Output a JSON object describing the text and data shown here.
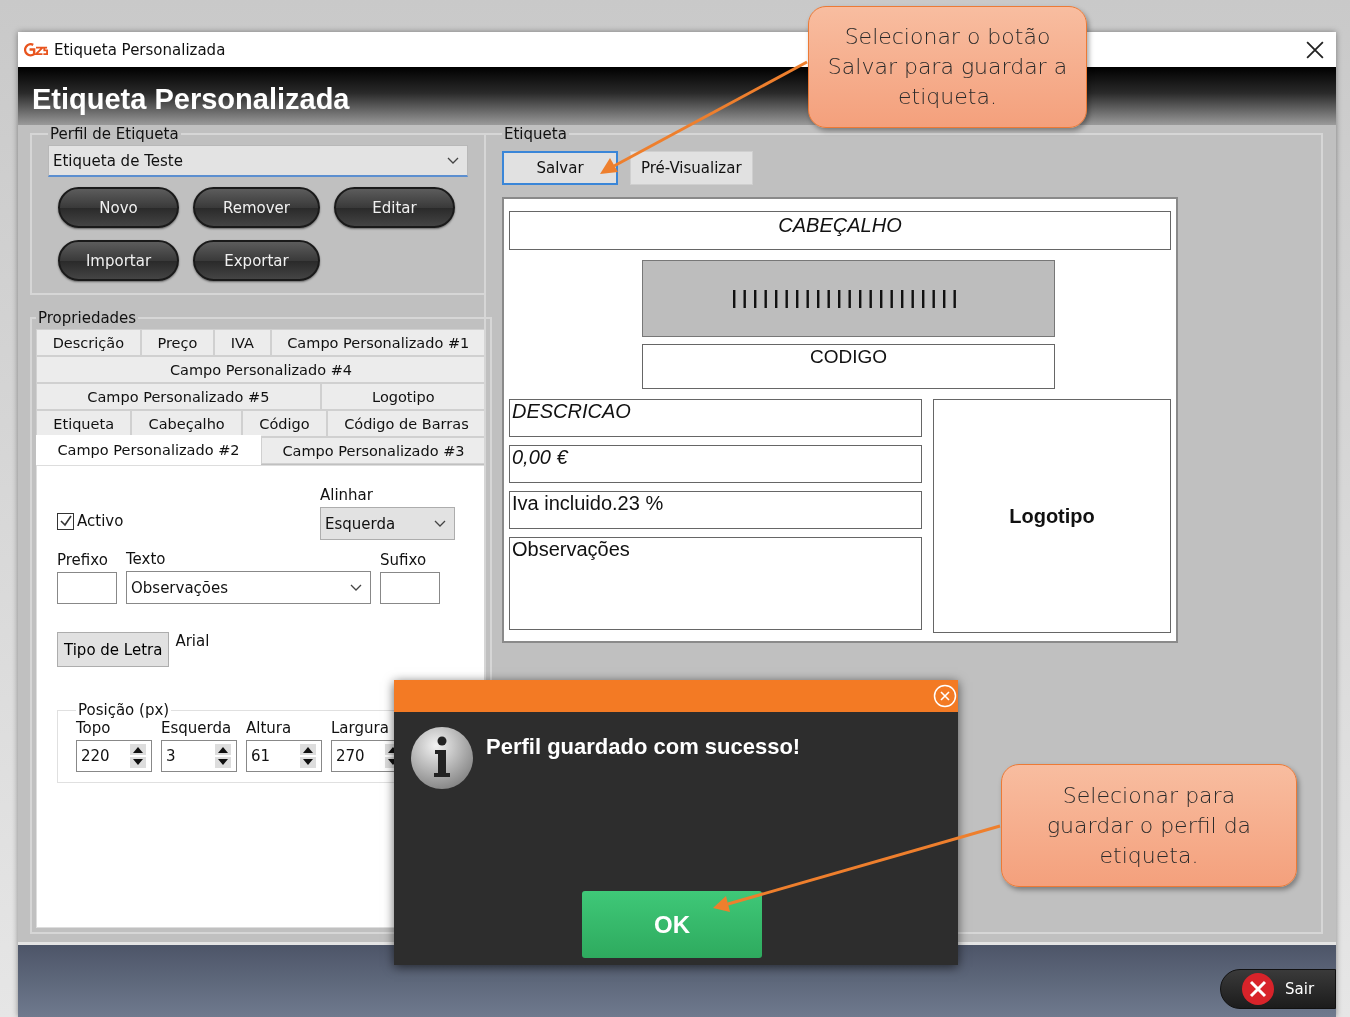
{
  "window": {
    "title": "Etiqueta Personalizada"
  },
  "header": {
    "title": "Etiqueta Personalizada"
  },
  "profile": {
    "legend": "Perfil de Etiqueta",
    "value": "Etiqueta de Teste",
    "buttons": [
      "Novo",
      "Remover",
      "Editar",
      "Importar",
      "Exportar"
    ]
  },
  "properties": {
    "legend": "Propriedades",
    "tab_rows": [
      [
        {
          "label": "Descrição",
          "selected": false
        },
        {
          "label": "Preço",
          "selected": false
        },
        {
          "label": "IVA",
          "selected": false
        },
        {
          "label": "Campo Personalizado #1",
          "selected": false
        }
      ],
      [
        {
          "label": "Campo Personalizado #4",
          "selected": false
        }
      ],
      [
        {
          "label": "Campo Personalizado #5",
          "selected": false
        },
        {
          "label": "Logotipo",
          "selected": false
        }
      ],
      [
        {
          "label": "Etiqueta",
          "selected": false
        },
        {
          "label": "Cabeçalho",
          "selected": false
        },
        {
          "label": "Código",
          "selected": false
        },
        {
          "label": "Código de Barras",
          "selected": false
        }
      ],
      [
        {
          "label": "Campo Personalizado #2",
          "selected": true
        },
        {
          "label": "Campo Personalizado #3",
          "selected": false
        }
      ]
    ],
    "active": {
      "label": "Activo",
      "checked": true
    },
    "align": {
      "label": "Alinhar",
      "value": "Esquerda"
    },
    "prefix": {
      "label": "Prefixo"
    },
    "text": {
      "label": "Texto",
      "value": "Observações"
    },
    "suffix": {
      "label": "Sufixo"
    },
    "font_button": "Tipo de Letra",
    "font_value": "Arial",
    "position": {
      "legend": "Posição (px)",
      "fields": [
        {
          "label": "Topo",
          "value": "220"
        },
        {
          "label": "Esquerda",
          "value": "3"
        },
        {
          "label": "Altura",
          "value": "61"
        },
        {
          "label": "Largura",
          "value": "270"
        }
      ]
    }
  },
  "label": {
    "legend": "Etiqueta",
    "buttons": [
      {
        "label": "Salvar",
        "focused": true
      },
      {
        "label": "Pré-Visualizar",
        "focused": false
      }
    ],
    "header": {
      "text": "CABEÇALHO",
      "kind": "italic"
    },
    "code": {
      "text": "CODIGO"
    },
    "fields": [
      {
        "text": "DESCRICAO",
        "kind": "italic"
      },
      {
        "text": "0,00 €",
        "kind": "italic"
      },
      {
        "text": "Iva incluido.23 %",
        "kind": "plain"
      },
      {
        "text": "Observações",
        "kind": "plain"
      }
    ],
    "logo": {
      "text": "Logotipo",
      "kind": "bold"
    }
  },
  "dialog": {
    "message": "Perfil guardado com sucesso!",
    "button": "OK"
  },
  "footer": {
    "exit": "Sair"
  },
  "callouts": [
    {
      "text": "Selecionar o botão Salvar para guardar a etiqueta."
    },
    {
      "text": "Selecionar para guardar o perfil da etiqueta."
    }
  ]
}
